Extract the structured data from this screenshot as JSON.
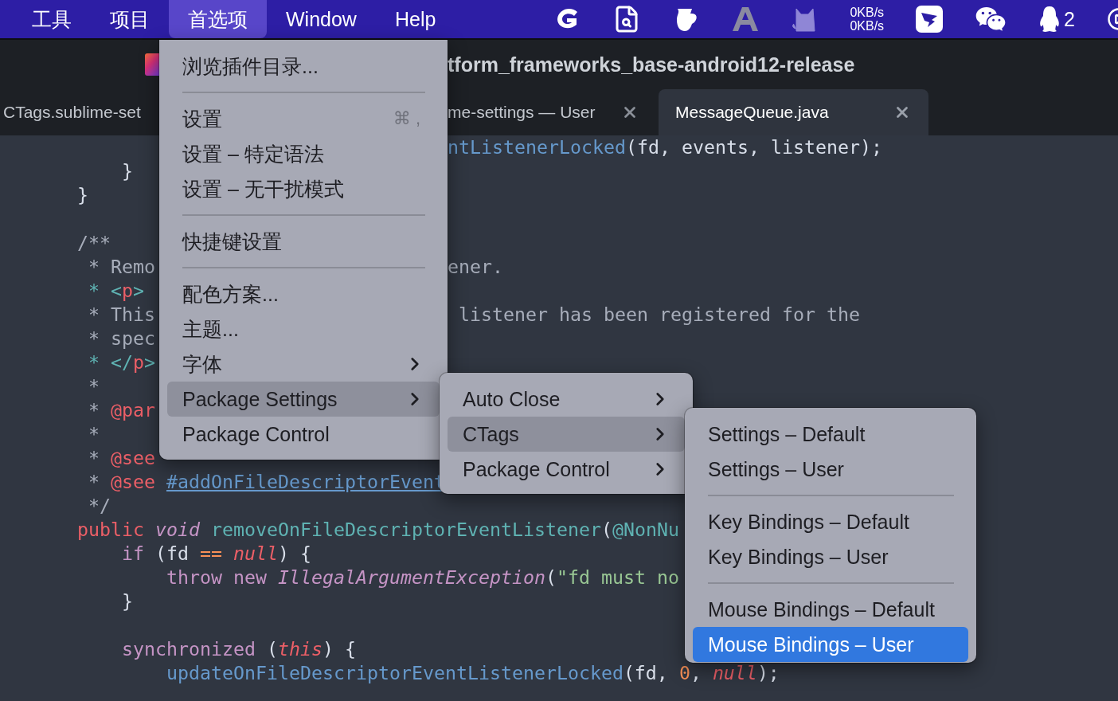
{
  "menu_bar": {
    "items": [
      {
        "label": "工具",
        "selected": false
      },
      {
        "label": "项目",
        "selected": false
      },
      {
        "label": "首选项",
        "selected": true
      },
      {
        "label": "Window",
        "selected": false
      },
      {
        "label": "Help",
        "selected": false
      }
    ],
    "net_speed": [
      "0KB/s",
      "0KB/s"
    ],
    "notification_count": "2"
  },
  "window": {
    "title": "tform_frameworks_base-android12-release"
  },
  "tabs": [
    {
      "label": "CTags.sublime-set",
      "selected": false,
      "has_close": false
    },
    {
      "label": "me-settings — User",
      "selected": false,
      "has_close": true
    },
    {
      "label": "MessageQueue.java",
      "selected": true,
      "has_close": true
    }
  ],
  "code_lines": [
    {
      "kind": "code",
      "right": [
        {
          "text": "ntListenerLocked",
          "kind": "call"
        },
        {
          "text": "(fd, events, listener);",
          "kind": "plain"
        }
      ]
    },
    {
      "kind": "code",
      "left": [
        {
          "text": "        }",
          "kind": "plain"
        }
      ]
    },
    {
      "kind": "code",
      "left": [
        {
          "text": "    }",
          "kind": "plain"
        }
      ]
    },
    {
      "kind": "blank"
    },
    {
      "kind": "code",
      "left": [
        {
          "text": "    /**",
          "kind": "comment"
        }
      ]
    },
    {
      "kind": "code",
      "left": [
        {
          "text": "     * Remo",
          "kind": "comment"
        }
      ],
      "right": [
        {
          "text": "ener.",
          "kind": "comment"
        }
      ]
    },
    {
      "kind": "code",
      "left": [
        {
          "text": "     * <",
          "kind": "tag"
        },
        {
          "text": "p",
          "kind": "tagname"
        },
        {
          "text": ">",
          "kind": "tag"
        }
      ]
    },
    {
      "kind": "code",
      "left": [
        {
          "text": "     * This",
          "kind": "comment"
        }
      ],
      "right": [
        {
          "text": " listener has been registered for the",
          "kind": "comment"
        }
      ]
    },
    {
      "kind": "code",
      "left": [
        {
          "text": "     * spec",
          "kind": "comment"
        }
      ]
    },
    {
      "kind": "code",
      "left": [
        {
          "text": "     * </",
          "kind": "tag"
        },
        {
          "text": "p",
          "kind": "tagname"
        },
        {
          "text": ">",
          "kind": "tag"
        }
      ]
    },
    {
      "kind": "code",
      "left": [
        {
          "text": "     *",
          "kind": "comment"
        }
      ]
    },
    {
      "kind": "code",
      "left": [
        {
          "text": "     * ",
          "kind": "comment"
        },
        {
          "text": "@par",
          "kind": "annotation"
        }
      ]
    },
    {
      "kind": "code",
      "left": [
        {
          "text": "     *",
          "kind": "comment"
        }
      ]
    },
    {
      "kind": "code",
      "left": [
        {
          "text": "     * ",
          "kind": "comment"
        },
        {
          "text": "@see",
          "kind": "annotation"
        }
      ]
    },
    {
      "kind": "code",
      "left": [
        {
          "text": "     * ",
          "kind": "comment"
        },
        {
          "text": "@see ",
          "kind": "annotation"
        },
        {
          "text": "#addOnFileDescriptorEvent",
          "kind": "link"
        }
      ]
    },
    {
      "kind": "code",
      "left": [
        {
          "text": "     */",
          "kind": "comment"
        }
      ]
    },
    {
      "kind": "code",
      "left": [
        {
          "text": "    public ",
          "kind": "keyword"
        },
        {
          "text": "void ",
          "kind": "storage"
        },
        {
          "text": "removeOnFileDescriptorEventListener",
          "kind": "function"
        },
        {
          "text": "(",
          "kind": "plain"
        },
        {
          "text": "@NonNu",
          "kind": "function"
        }
      ]
    },
    {
      "kind": "code",
      "left": [
        {
          "text": "        if",
          "kind": "control"
        },
        {
          "text": " (fd ",
          "kind": "plain"
        },
        {
          "text": "== ",
          "kind": "operator"
        },
        {
          "text": "null",
          "kind": "constant"
        },
        {
          "text": ") {",
          "kind": "plain"
        }
      ]
    },
    {
      "kind": "code",
      "left": [
        {
          "text": "            throw new ",
          "kind": "control"
        },
        {
          "text": "IllegalArgumentException",
          "kind": "class"
        },
        {
          "text": "(",
          "kind": "plain"
        },
        {
          "text": "\"fd must no",
          "kind": "string"
        }
      ]
    },
    {
      "kind": "code",
      "left": [
        {
          "text": "        }",
          "kind": "plain"
        }
      ]
    },
    {
      "kind": "blank"
    },
    {
      "kind": "code",
      "left": [
        {
          "text": "        synchronized",
          "kind": "control"
        },
        {
          "text": " (",
          "kind": "plain"
        },
        {
          "text": "this",
          "kind": "constant"
        },
        {
          "text": ") {",
          "kind": "plain"
        }
      ]
    },
    {
      "kind": "code",
      "left": [
        {
          "text": "            updateOnFileDescriptorEventListenerLocked",
          "kind": "call"
        },
        {
          "text": "(fd, ",
          "kind": "plain"
        },
        {
          "text": "0",
          "kind": "number"
        },
        {
          "text": ", ",
          "kind": "plain"
        },
        {
          "text": "null",
          "kind": "constant"
        },
        {
          "text": ");",
          "kind": "plain"
        }
      ]
    }
  ],
  "menus": [
    {
      "items": [
        {
          "kind": "item",
          "label": "浏览插件目录...",
          "selected": false
        },
        {
          "kind": "separator"
        },
        {
          "kind": "item",
          "label": "设置",
          "shortcut": "⌘ ,",
          "selected": false
        },
        {
          "kind": "item",
          "label": "设置 – 特定语法",
          "selected": false
        },
        {
          "kind": "item",
          "label": "设置 – 无干扰模式",
          "selected": false
        },
        {
          "kind": "separator"
        },
        {
          "kind": "item",
          "label": "快捷键设置",
          "selected": false
        },
        {
          "kind": "separator"
        },
        {
          "kind": "item",
          "label": "配色方案...",
          "selected": false
        },
        {
          "kind": "item",
          "label": "主题...",
          "selected": false
        },
        {
          "kind": "item",
          "label": "字体",
          "submenu": true,
          "selected": false
        },
        {
          "kind": "item",
          "label": "Package Settings",
          "submenu": true,
          "selected": true
        },
        {
          "kind": "item",
          "label": "Package Control",
          "selected": false
        }
      ]
    },
    {
      "items": [
        {
          "kind": "item",
          "label": "Auto Close",
          "submenu": true,
          "selected": false
        },
        {
          "kind": "item",
          "label": "CTags",
          "submenu": true,
          "selected": true
        },
        {
          "kind": "item",
          "label": "Package Control",
          "submenu": true,
          "selected": false
        }
      ]
    },
    {
      "items": [
        {
          "kind": "item",
          "label": "Settings – Default",
          "selected": false
        },
        {
          "kind": "item",
          "label": "Settings – User",
          "selected": false
        },
        {
          "kind": "separator"
        },
        {
          "kind": "item",
          "label": "Key Bindings – Default",
          "selected": false
        },
        {
          "kind": "item",
          "label": "Key Bindings – User",
          "selected": false
        },
        {
          "kind": "separator"
        },
        {
          "kind": "item",
          "label": "Mouse Bindings – Default",
          "selected": false
        },
        {
          "kind": "item",
          "label": "Mouse Bindings – User",
          "selected": true
        }
      ]
    }
  ]
}
